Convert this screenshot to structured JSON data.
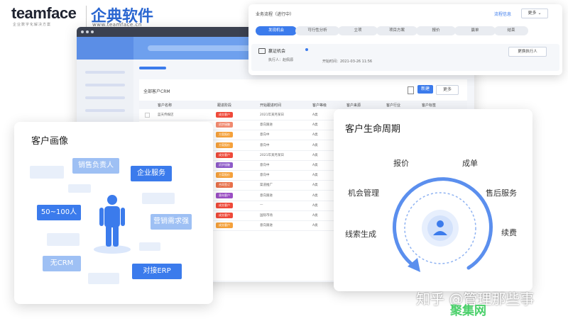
{
  "logo": {
    "en": "teamface",
    "tagline": "企业数字化解决方案",
    "cn": "企典软件",
    "url": "www.teamface.cn"
  },
  "browser": {
    "url": "● ● ●  WWW",
    "content_title": "全部客户CRM",
    "new_btn": "新建",
    "more_btn": "更多",
    "columns": [
      "客户名称",
      "跟进阶段",
      "开始跟进时间",
      "客户等级",
      "客户来源",
      "客户行业",
      "客户标签"
    ],
    "rows": [
      {
        "name": "蓝天传媒店",
        "stage": "成交客户",
        "stage_color": "#ef4a3a",
        "date": "2021年某月某日",
        "level": "A类"
      },
      {
        "name": "",
        "stage": "初步接触",
        "stage_color": "#f08a70",
        "date": "意向跟进",
        "level": "A类"
      },
      {
        "name": "",
        "stage": "方案报价",
        "stage_color": "#f5a13b",
        "date": "意向中",
        "level": "A类"
      },
      {
        "name": "",
        "stage": "方案报价",
        "stage_color": "#f5a13b",
        "date": "意向中",
        "level": "A类"
      },
      {
        "name": "",
        "stage": "成交客户",
        "stage_color": "#ef4a3a",
        "date": "2021年某月某日",
        "level": "A类"
      },
      {
        "name": "",
        "stage": "初步接触",
        "stage_color": "#8e5bc9",
        "date": "意向中",
        "level": "A类"
      },
      {
        "name": "",
        "stage": "方案报价",
        "stage_color": "#f5a13b",
        "date": "意向中",
        "level": "A类"
      },
      {
        "name": "",
        "stage": "合同签订",
        "stage_color": "#e8704a",
        "date": "渠道推广",
        "level": "A类"
      },
      {
        "name": "",
        "stage": "意向客户",
        "stage_color": "#9b4fc4",
        "date": "意向跟进",
        "level": "A类"
      },
      {
        "name": "",
        "stage": "成交客户",
        "stage_color": "#ef4a3a",
        "date": "—",
        "level": "A类"
      },
      {
        "name": "",
        "stage": "成交客户",
        "stage_color": "#ef4a3a",
        "date": "国际市场",
        "level": "A类"
      },
      {
        "name": "",
        "stage": "成交客户",
        "stage_color": "#f5a13b",
        "date": "意向跟进",
        "level": "A类"
      }
    ]
  },
  "process": {
    "title": "业务流程（进行中）",
    "link": "流程信息",
    "more": "更多 ⌄",
    "steps": [
      "发现机会",
      "可行性分析",
      "立项",
      "项目方案",
      "报价",
      "赢单",
      "结束"
    ],
    "card_name": "赢证机会",
    "executor": "执行人：赵佩源",
    "start": "开始时间：2021-03-26 11:56",
    "change_btn": "更换执行人"
  },
  "portrait": {
    "title": "客户画像",
    "chips": [
      {
        "label": "销售负责人",
        "style": "light"
      },
      {
        "label": "企业服务",
        "style": "dark"
      },
      {
        "label": "50~100人",
        "style": "dark"
      },
      {
        "label": "营销需求强",
        "style": "light"
      },
      {
        "label": "无CRM",
        "style": "light"
      },
      {
        "label": "对接ERP",
        "style": "dark"
      }
    ]
  },
  "lifecycle": {
    "title": "客户生命周期",
    "labels": [
      "报价",
      "成单",
      "机会管理",
      "售后服务",
      "线索生成",
      "续费"
    ]
  },
  "watermark": {
    "line1": "知乎 @管理那些事",
    "line2": "聚集网"
  },
  "colors": {
    "accent": "#3b7bec",
    "light_accent": "#9ec0f4"
  }
}
